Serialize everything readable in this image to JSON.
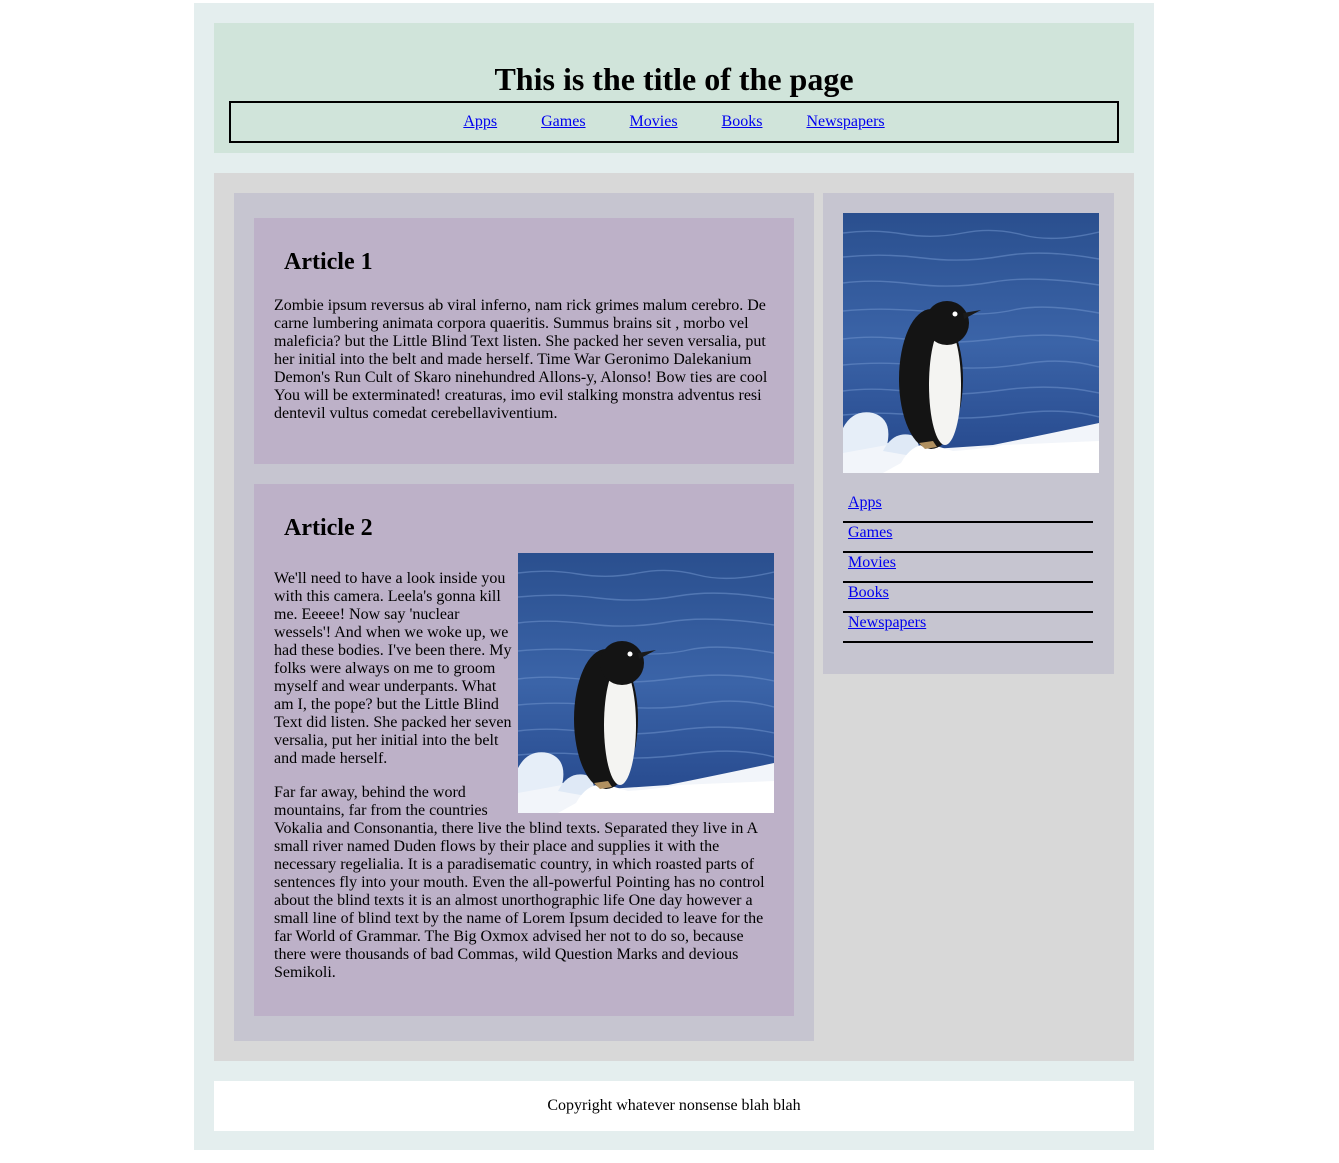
{
  "header": {
    "title": "This is the title of the page",
    "nav": [
      "Apps",
      "Games",
      "Movies",
      "Books",
      "Newspapers"
    ]
  },
  "articles": [
    {
      "heading": "Article 1",
      "paragraphs": [
        "Zombie ipsum reversus ab viral inferno, nam rick grimes malum cerebro. De carne lumbering animata corpora quaeritis. Summus brains sit , morbo vel maleficia? but the Little Blind Text listen. She packed her seven versalia, put her initial into the belt and made herself. Time War Geronimo Dalekanium Demon's Run Cult of Skaro ninehundred Allons-y, Alonso! Bow ties are cool You will be exterminated! creaturas, imo evil stalking monstra adventus resi dentevil vultus comedat cerebellaviventium."
      ]
    },
    {
      "heading": "Article 2",
      "image": "penguin-on-ice-photo",
      "paragraphs": [
        "We'll need to have a look inside you with this camera. Leela's gonna kill me. Eeeee! Now say 'nuclear wessels'! And when we woke up, we had these bodies. I've been there. My folks were always on me to groom myself and wear underpants. What am I, the pope? but the Little Blind Text did listen. She packed her seven versalia, put her initial into the belt and made herself.",
        "Far far away, behind the word mountains, far from the countries Vokalia and Consonantia, there live the blind texts. Separated they live in A small river named Duden flows by their place and supplies it with the necessary regelialia. It is a paradisematic country, in which roasted parts of sentences fly into your mouth. Even the all-powerful Pointing has no control about the blind texts it is an almost unorthographic life One day however a small line of blind text by the name of Lorem Ipsum decided to leave for the far World of Grammar. The Big Oxmox advised her not to do so, because there were thousands of bad Commas, wild Question Marks and devious Semikoli."
      ]
    }
  ],
  "sidebar": {
    "image": "penguin-on-ice-photo",
    "nav": [
      "Apps",
      "Games",
      "Movies",
      "Books",
      "Newspapers"
    ]
  },
  "footer": {
    "text": "Copyright whatever nonsense blah blah"
  },
  "colors": {
    "page_bg": "#e4eeee",
    "header_bg": "#d0e4da",
    "content_bg": "#d8d8d8",
    "column_bg": "#c6c5d0",
    "article_bg": "#bdb1c8",
    "link": "#0000ee"
  }
}
